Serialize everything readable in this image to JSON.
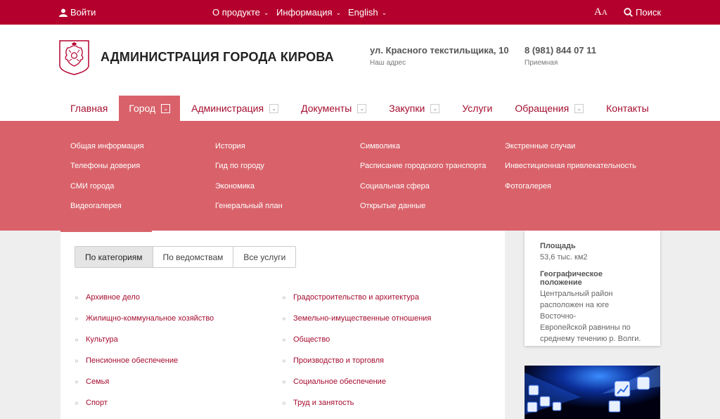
{
  "topbar": {
    "login_label": "Войти",
    "about_label": "О продукте",
    "info_label": "Информация",
    "lang_label": "English",
    "font_size_label_big": "A",
    "font_size_label_small": "A",
    "search_label": "Поиск"
  },
  "header": {
    "title": "АДМИНИСТРАЦИЯ ГОРОДА КИРОВА",
    "address": "ул. Красного текстильщика, 10",
    "address_caption": "Наш адрес",
    "phone": "8 (981) 844 07 11",
    "phone_caption": "Приемная"
  },
  "nav": {
    "items": [
      {
        "label": "Главная"
      },
      {
        "label": "Город"
      },
      {
        "label": "Администрация"
      },
      {
        "label": "Документы"
      },
      {
        "label": "Закупки"
      },
      {
        "label": "Услуги"
      },
      {
        "label": "Обращения"
      },
      {
        "label": "Контакты"
      }
    ]
  },
  "dropdown": {
    "items": [
      "Общая информация",
      "Телефоны доверия",
      "СМИ города",
      "Видеогалерея",
      "История",
      "Гид по городу",
      "Экономика",
      "Генеральный план",
      "Символика",
      "Расписание городского транспорта",
      "Социальная сфера",
      "Открытые данные",
      "Экстренные случаи",
      "Инвестиционная привлекательность",
      "Фотогалерея"
    ]
  },
  "services": {
    "tabs": [
      "По категориям",
      "По ведомствам",
      "Все услуги"
    ],
    "categories": [
      "Архивное дело",
      "Жилищно-коммунальное хозяйство",
      "Культура",
      "Пенсионное обеспечение",
      "Семья",
      "Спорт",
      "Градостроительство и архитектура",
      "Земельно-имущественные отношения",
      "Общество",
      "Производство и торговля",
      "Социальное обеспечение",
      "Труд и занятость"
    ]
  },
  "city_info": {
    "area_label": "Площадь",
    "area_value": "53,6 тыс. км2",
    "geo_label": "Географическое положение",
    "geo_lines": [
      "Центральный район",
      "расположен на юге Восточно-",
      "Европейской равнины по",
      "среднему течению р. Волги."
    ]
  },
  "colors": {
    "brand": "#b4002d",
    "menu_bg": "#d9626a",
    "link": "#a50d2e"
  }
}
